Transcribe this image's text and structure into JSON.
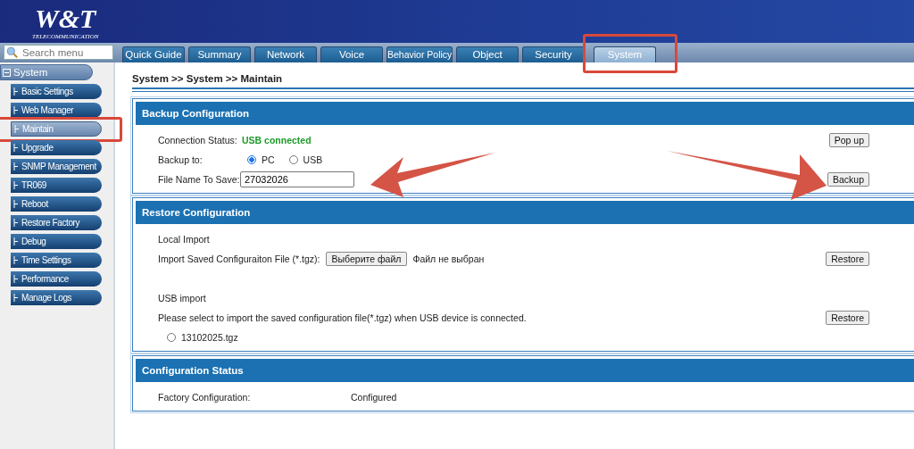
{
  "logo": {
    "mark": "W&T",
    "subtitle": "TELECOMMUNICATION"
  },
  "search": {
    "placeholder": "Search menu"
  },
  "tabs": [
    {
      "label": "Quick Guide",
      "selected": false,
      "highlighted": false
    },
    {
      "label": "Summary",
      "selected": false,
      "highlighted": false
    },
    {
      "label": "Network",
      "selected": false,
      "highlighted": false
    },
    {
      "label": "Voice",
      "selected": false,
      "highlighted": false
    },
    {
      "label": "Behavior Policy",
      "selected": false,
      "highlighted": false
    },
    {
      "label": "Object",
      "selected": false,
      "highlighted": false
    },
    {
      "label": "Security",
      "selected": false,
      "highlighted": false
    },
    {
      "label": "System",
      "selected": true,
      "highlighted": true
    }
  ],
  "sidebar": {
    "group": {
      "label": "System",
      "expanded": true
    },
    "items": [
      {
        "label": "Basic Settings",
        "selected": false,
        "highlighted": false
      },
      {
        "label": "Web Manager",
        "selected": false,
        "highlighted": false
      },
      {
        "label": "Maintain",
        "selected": true,
        "highlighted": true
      },
      {
        "label": "Upgrade",
        "selected": false,
        "highlighted": false
      },
      {
        "label": "SNMP Management",
        "selected": false,
        "highlighted": false
      },
      {
        "label": "TR069",
        "selected": false,
        "highlighted": false
      },
      {
        "label": "Reboot",
        "selected": false,
        "highlighted": false
      },
      {
        "label": "Restore Factory",
        "selected": false,
        "highlighted": false
      },
      {
        "label": "Debug",
        "selected": false,
        "highlighted": false
      },
      {
        "label": "Time Settings",
        "selected": false,
        "highlighted": false
      },
      {
        "label": "Performance",
        "selected": false,
        "highlighted": false
      },
      {
        "label": "Manage Logs",
        "selected": false,
        "highlighted": false
      }
    ]
  },
  "breadcrumb": "System >> System >>  Maintain",
  "backup": {
    "title": "Backup Configuration",
    "connection_label": "Connection Status:",
    "connection_value": "USB connected",
    "popup_button": "Pop up",
    "backup_to_label": "Backup to:",
    "targets": [
      {
        "label": "PC",
        "selected": true
      },
      {
        "label": "USB",
        "selected": false
      }
    ],
    "filename_label": "File Name To Save:",
    "filename_value": "27032026",
    "backup_button": "Backup"
  },
  "restore": {
    "title": "Restore Configuration",
    "local_title": "Local Import",
    "import_label": "Import Saved Configuraiton File (*.tgz):",
    "choose_button": "Выберите файл",
    "no_file": "Файл не выбран",
    "local_restore_button": "Restore",
    "usb_title": "USB import",
    "usb_hint": "Please select to import the saved configuration file(*.tgz) when USB device is connected.",
    "usb_restore_button": "Restore",
    "files": [
      {
        "label": "13102025.tgz",
        "selected": false
      }
    ]
  },
  "status": {
    "title": "Configuration Status",
    "label": "Factory Configuration:",
    "value": "Configured"
  }
}
